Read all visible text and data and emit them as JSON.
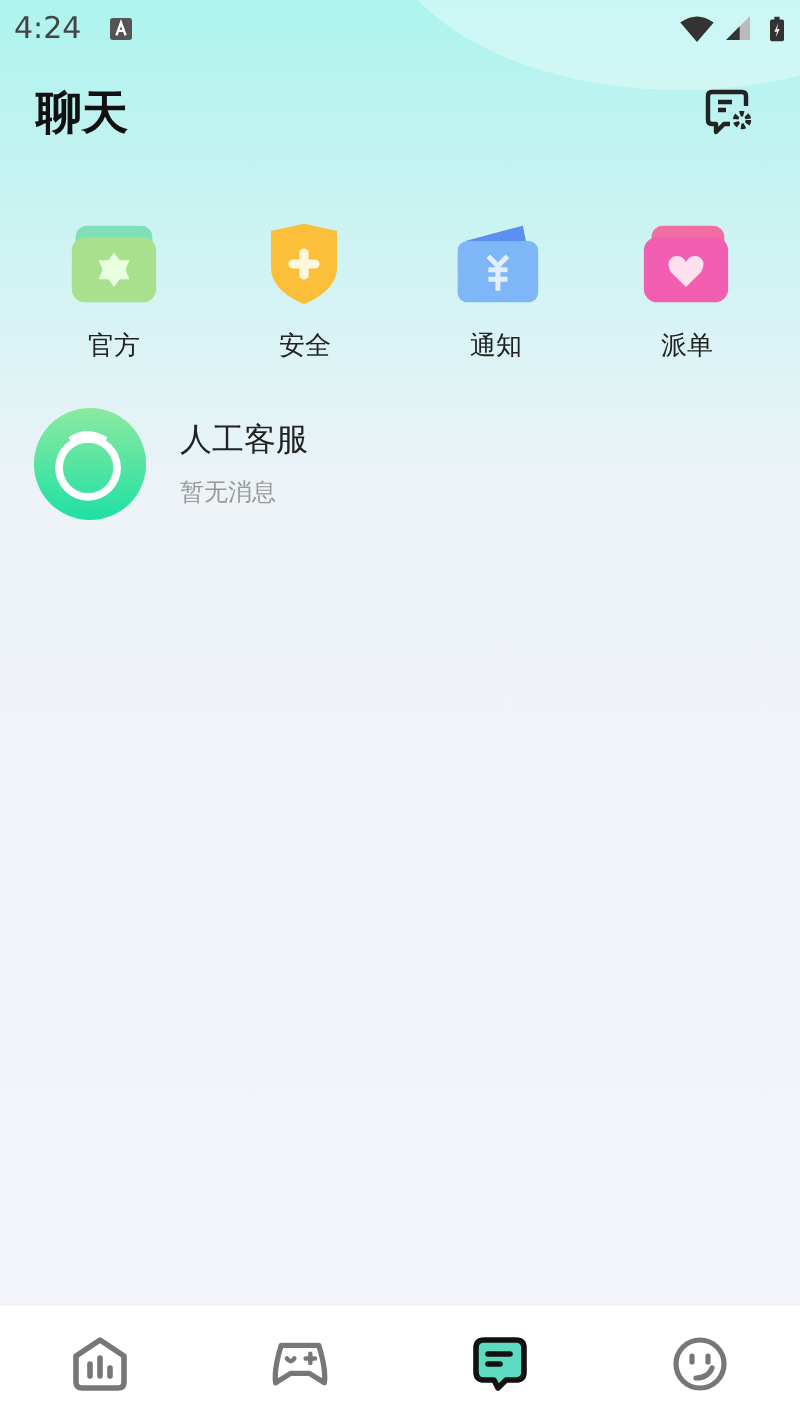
{
  "status_bar": {
    "time": "4:24"
  },
  "header": {
    "title": "聊天"
  },
  "categories": [
    {
      "kind": "official",
      "label": "官方"
    },
    {
      "kind": "security",
      "label": "安全"
    },
    {
      "kind": "notice",
      "label": "通知"
    },
    {
      "kind": "dispatch",
      "label": "派单"
    }
  ],
  "conversations": [
    {
      "name": "人工客服",
      "preview": "暂无消息"
    }
  ],
  "bottom_nav": [
    {
      "kind": "stats",
      "selected": false
    },
    {
      "kind": "game",
      "selected": false
    },
    {
      "kind": "chat",
      "selected": true
    },
    {
      "kind": "face",
      "selected": false
    }
  ]
}
